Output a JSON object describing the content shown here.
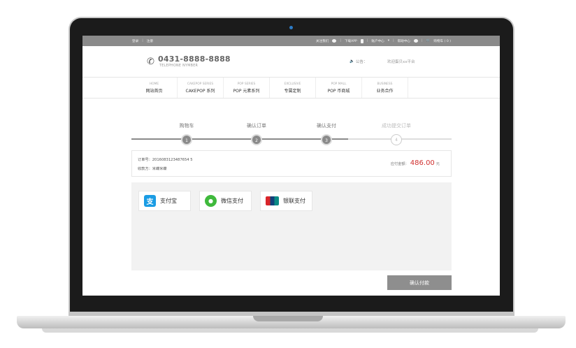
{
  "topbar": {
    "login": "登录",
    "register": "注册",
    "follow": "关注我们",
    "download_app": "下载APP",
    "account_center": "账户中心",
    "help_center": "帮助中心",
    "cart": "购物车 ( 0 )"
  },
  "header": {
    "phone": "0431-8888-8888",
    "phone_sub": "TELEPHONE NYMBER",
    "notice": "公告：",
    "welcome": "欢迎蛋贝xx平台"
  },
  "nav": [
    {
      "en": "HOME",
      "cn": "网站首页"
    },
    {
      "en": "CAKEPOP SERIES",
      "cn": "CAKEPOP 系列"
    },
    {
      "en": "POP SERIES",
      "cn": "POP 元素系列"
    },
    {
      "en": "EXCLUSIVE",
      "cn": "专属定制"
    },
    {
      "en": "POP MALL",
      "cn": "POP 币商城"
    },
    {
      "en": "BUSINESS",
      "cn": "业务合作"
    }
  ],
  "steps": [
    {
      "label": "购物车",
      "num": "1",
      "state": "done"
    },
    {
      "label": "确认订单",
      "num": "2",
      "state": "done"
    },
    {
      "label": "确认支付",
      "num": "3",
      "state": "done"
    },
    {
      "label": "成功提交订单",
      "num": "4",
      "state": "pending"
    }
  ],
  "order": {
    "number": "订单号：2016083123487654 5",
    "payee": "收款方：米蝶米蝶",
    "amount_label": "应付金额：",
    "amount": "486.00",
    "unit": "元"
  },
  "payment": {
    "alipay": "支付宝",
    "wechat": "微信支付",
    "union": "银联支付"
  },
  "confirm_label": "确认付款",
  "colors": {
    "accent_red": "#d0302f",
    "topbar": "#8a8a8a",
    "button": "#8e8e8e"
  }
}
